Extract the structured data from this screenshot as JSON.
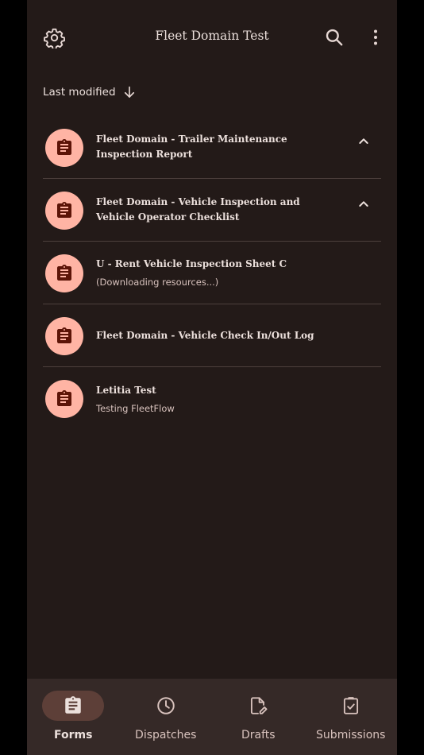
{
  "header": {
    "title": "Fleet Domain Test",
    "settings_icon": "gear-icon",
    "search_icon": "search-icon",
    "more_icon": "more-vert-icon"
  },
  "sort": {
    "label": "Last modified",
    "direction_icon": "arrow-down-icon"
  },
  "forms": [
    {
      "title": "Fleet Domain - Trailer Maintenance Inspection Report",
      "subtitle": "",
      "icon": "clipboard-icon",
      "expandable": true,
      "expand_icon": "chevron-up-icon"
    },
    {
      "title": "Fleet Domain - Vehicle Inspection and Vehicle Operator Checklist",
      "subtitle": "",
      "icon": "clipboard-icon",
      "expandable": true,
      "expand_icon": "chevron-up-icon"
    },
    {
      "title": "U - Rent Vehicle Inspection Sheet C",
      "subtitle": "(Downloading resources...)",
      "icon": "clipboard-icon",
      "expandable": false
    },
    {
      "title": "Fleet Domain - Vehicle Check In/Out Log",
      "subtitle": "",
      "icon": "clipboard-icon",
      "expandable": false
    },
    {
      "title": "Letitia Test",
      "subtitle": "Testing FleetFlow",
      "icon": "clipboard-icon",
      "expandable": false
    }
  ],
  "bottom_nav": [
    {
      "label": "Forms",
      "icon": "clipboard-icon",
      "active": true
    },
    {
      "label": "Dispatches",
      "icon": "clock-icon",
      "active": false
    },
    {
      "label": "Drafts",
      "icon": "draft-edit-icon",
      "active": false
    },
    {
      "label": "Submissions",
      "icon": "clipboard-check-icon",
      "active": false
    }
  ],
  "colors": {
    "background": "#231a18",
    "surface_nav": "#352927",
    "avatar": "#ffb4a4",
    "avatar_icon": "#5c1407",
    "active_pill": "#5d3f38",
    "text": "#ece0dc",
    "muted_text": "#d8c2bd",
    "divider": "#4d403d"
  }
}
